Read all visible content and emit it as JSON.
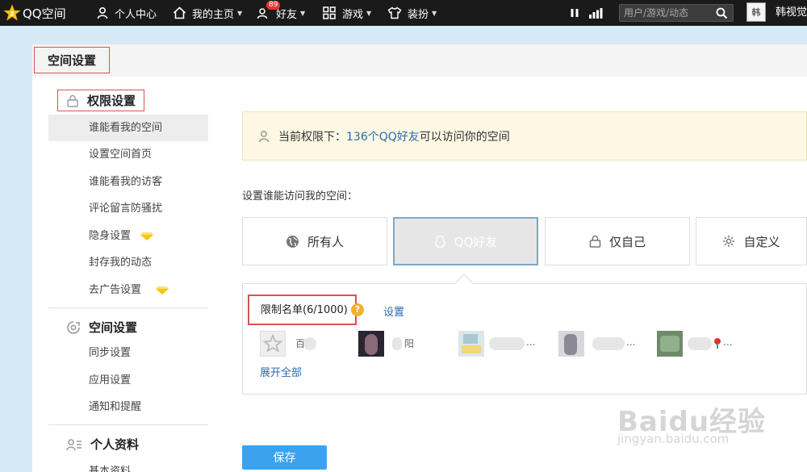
{
  "topbar": {
    "logo_text": "QQ空间",
    "nav": [
      {
        "label": "个人中心",
        "icon": "user-icon"
      },
      {
        "label": "我的主页",
        "icon": "home-icon"
      },
      {
        "label": "好友",
        "icon": "friends-icon",
        "badge": "89"
      },
      {
        "label": "游戏",
        "icon": "grid-icon"
      },
      {
        "label": "装扮",
        "icon": "tshirt-icon"
      }
    ],
    "search_placeholder": "用户/游戏/动态",
    "avatar_text": "韩",
    "username": "韩视觉"
  },
  "page": {
    "title": "空间设置"
  },
  "sidebar": {
    "groups": [
      {
        "title": "权限设置",
        "icon": "lock-icon",
        "items": [
          "谁能看我的空间",
          "设置空间首页",
          "谁能看我的访客",
          "评论留言防骚扰",
          "隐身设置",
          "封存我的动态",
          "去广告设置"
        ]
      },
      {
        "title": "空间设置",
        "icon": "space-settings-icon",
        "items": [
          "同步设置",
          "应用设置",
          "通知和提醒"
        ]
      },
      {
        "title": "个人资料",
        "icon": "profile-icon",
        "items": [
          "基本资料"
        ]
      }
    ]
  },
  "notice": {
    "prefix": "当前权限下：",
    "highlight": "136个QQ好友",
    "suffix": "可以访问你的空间"
  },
  "access": {
    "label": "设置谁能访问我的空间：",
    "options": [
      {
        "label": "所有人",
        "icon": "globe-icon"
      },
      {
        "label": "QQ好友",
        "icon": "qq-penguin-icon",
        "selected": true
      },
      {
        "label": "仅自己",
        "icon": "lock-icon"
      },
      {
        "label": "自定义",
        "icon": "gear-icon"
      }
    ]
  },
  "restrict": {
    "title": "限制名单(6/1000)",
    "help": "?",
    "set_link": "设置",
    "friends": [
      {
        "name": "百"
      },
      {
        "name": "阳"
      },
      {
        "name": "..."
      },
      {
        "name": "..."
      },
      {
        "name": "..."
      }
    ],
    "expand": "展开全部"
  },
  "save_label": "保存",
  "watermark": {
    "brand": "Baidu经验",
    "url": "jingyan.baidu.com"
  },
  "colors": {
    "topbar_bg": "#1a1a1a",
    "link_blue": "#2a6ab0",
    "save_blue": "#3aa3f0",
    "highlight_red": "#d9534f",
    "page_bg": "#d6e9f6"
  }
}
